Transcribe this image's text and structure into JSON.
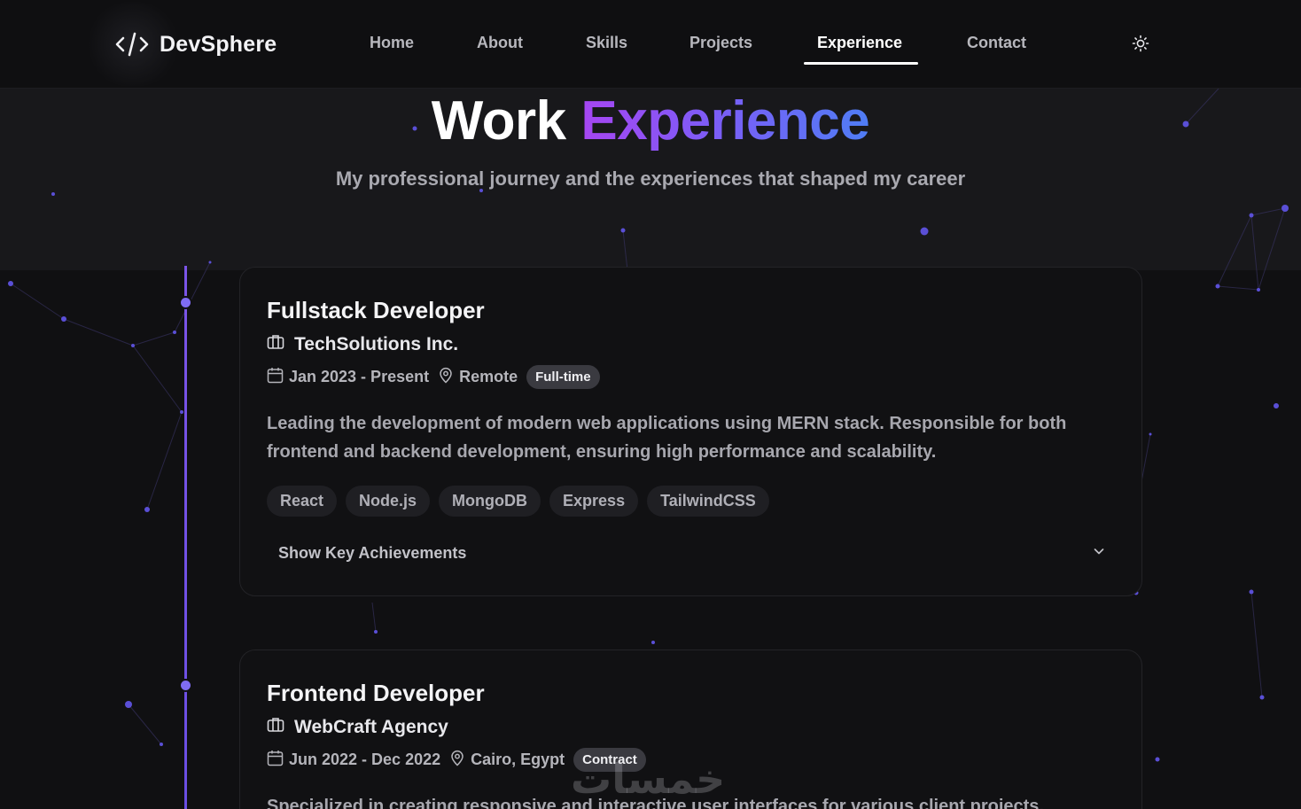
{
  "brand": {
    "name": "DevSphere",
    "icon": "code-icon"
  },
  "nav": {
    "items": [
      {
        "label": "Home"
      },
      {
        "label": "About"
      },
      {
        "label": "Skills"
      },
      {
        "label": "Projects"
      },
      {
        "label": "Experience",
        "active": true
      },
      {
        "label": "Contact"
      }
    ],
    "theme_toggle_icon": "sun-icon"
  },
  "header": {
    "title_part1": "Work",
    "title_part2": "Experience",
    "subtitle": "My professional journey and the experiences that shaped my career"
  },
  "experiences": [
    {
      "title": "Fullstack Developer",
      "company": "TechSolutions Inc.",
      "dates": "Jan 2023 - Present",
      "location": "Remote",
      "type": "Full-time",
      "description": "Leading the development of modern web applications using MERN stack. Responsible for both frontend and backend development, ensuring high performance and scalability.",
      "tags": [
        "React",
        "Node.js",
        "MongoDB",
        "Express",
        "TailwindCSS"
      ],
      "toggle_label": "Show Key Achievements"
    },
    {
      "title": "Frontend Developer",
      "company": "WebCraft Agency",
      "dates": "Jun 2022 - Dec 2022",
      "location": "Cairo, Egypt",
      "type": "Contract",
      "description": "Specialized in creating responsive and interactive user interfaces for various client projects."
    }
  ],
  "watermark": "خمسات",
  "colors": {
    "accent_purple": "#a646f2",
    "accent_blue": "#4f7df5",
    "timeline": "#7b54e8",
    "background": "#101012"
  }
}
